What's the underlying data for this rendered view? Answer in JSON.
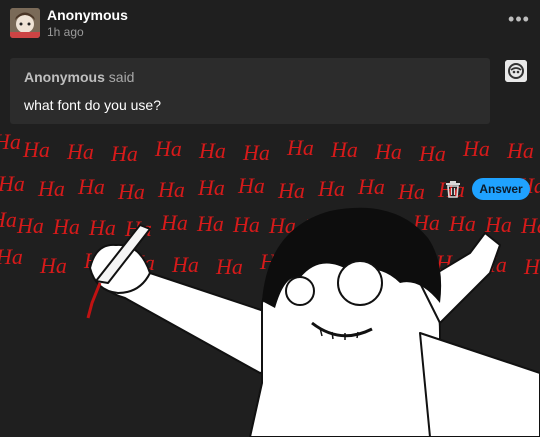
{
  "post": {
    "author": "Anonymous",
    "time_ago": "1h ago",
    "more_label": "•••"
  },
  "ask": {
    "asker": "Anonymous",
    "said": "said",
    "question": "what font do you use?"
  },
  "actions": {
    "answer_label": "Answer",
    "accent_color": "#1fa2ff"
  },
  "icons": [
    "avatar",
    "more-options-icon",
    "asker-avatar-icon",
    "trash-icon"
  ],
  "artwork": {
    "laugh_text": "Ha",
    "laugh_color": "#d61a1a"
  }
}
